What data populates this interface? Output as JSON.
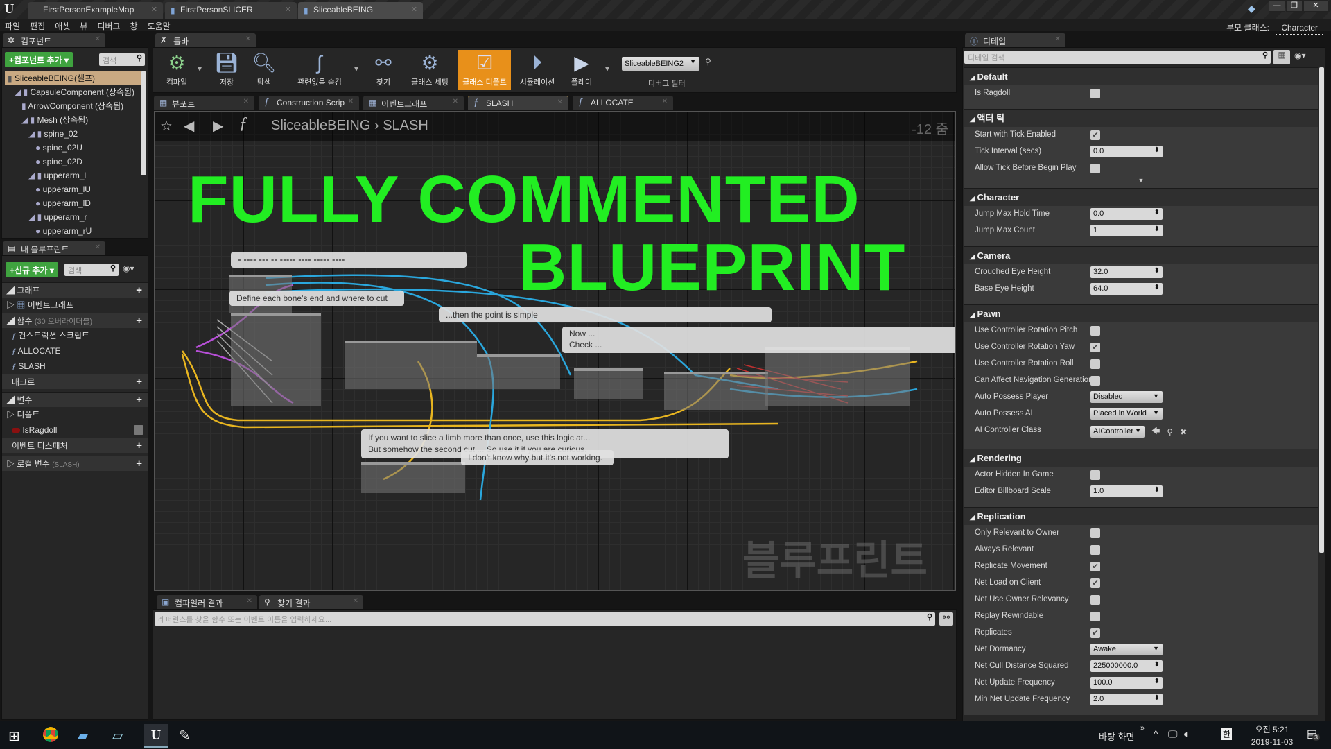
{
  "window": {
    "tabs": [
      "FirstPersonExampleMap",
      "FirstPersonSLICER",
      "SliceableBEING"
    ],
    "active_tab": 2,
    "controls": [
      "—",
      "❐",
      "✕"
    ]
  },
  "menu": [
    "파일",
    "편집",
    "애셋",
    "뷰",
    "디버그",
    "창",
    "도움말"
  ],
  "parent_class": {
    "label": "부모 클래스:",
    "value": "Character"
  },
  "components": {
    "tab": "컴포넌트",
    "add_button": "+컴포넌트 추가",
    "search_placeholder": "검색",
    "tree": [
      {
        "label": "SliceableBEING(셀프)",
        "depth": 0
      },
      {
        "label": "CapsuleComponent (상속됨)",
        "depth": 1
      },
      {
        "label": "ArrowComponent (상속됨)",
        "depth": 2
      },
      {
        "label": "Mesh (상속됨)",
        "depth": 2
      },
      {
        "label": "spine_02",
        "depth": 3
      },
      {
        "label": "spine_02U",
        "depth": 4
      },
      {
        "label": "spine_02D",
        "depth": 4
      },
      {
        "label": "upperarm_l",
        "depth": 3
      },
      {
        "label": "upperarm_lU",
        "depth": 4
      },
      {
        "label": "upperarm_lD",
        "depth": 4
      },
      {
        "label": "upperarm_r",
        "depth": 3
      },
      {
        "label": "upperarm_rU",
        "depth": 4
      }
    ]
  },
  "my_blueprint": {
    "tab": "내 블루프린트",
    "add_button": "+신규 추가",
    "search_placeholder": "검색",
    "graphs_header": "그래프",
    "event_graph": "이벤트그래프",
    "functions_header": "함수",
    "functions_note": "(30 오버라이더블)",
    "functions": [
      "컨스트럭션 스크립트",
      "ALLOCATE",
      "SLASH"
    ],
    "macros_header": "매크로",
    "variables_header": "변수",
    "defaults_category": "디폴트",
    "variable": "IsRagdoll",
    "dispatchers_header": "이벤트 디스패처",
    "local_vars_header": "로컬 변수",
    "local_vars_note": "(SLASH)"
  },
  "toolbar": {
    "tab": "툴바",
    "buttons": [
      "컴파일",
      "저장",
      "탐색",
      "관련없음 숨김",
      "찾기",
      "클래스 세팅",
      "클래스 디폴트",
      "시뮬레이션",
      "플레이"
    ],
    "active_button": "클래스 디폴트",
    "debug_object": "SliceableBEING2",
    "debug_filter": "디버그 필터"
  },
  "graph_tabs": [
    "뷰포트",
    "Construction Scrip",
    "이벤트그래프",
    "SLASH",
    "ALLOCATE"
  ],
  "active_graph_tab": "SLASH",
  "breadcrumb": [
    "SliceableBEING",
    "SLASH"
  ],
  "zoom_level": "-12 줌",
  "graph": {
    "headline_1": "FULLY COMMENTED",
    "headline_2": "BLUEPRINT",
    "headline_color": "#22ee22",
    "watermark": "블루프린트",
    "comments": [
      "Define each bone's end and where to cut",
      "Now ...",
      "Check ...",
      "...then the point is simple",
      "If you want to slice a limb more than once, use this logic at...",
      "But somehow the second cut ... So use it if you are curious.",
      "I don't know why but it's not working."
    ]
  },
  "results": {
    "tabs": [
      "컴파일러 결과",
      "찾기 결과"
    ],
    "search_placeholder": "레퍼런스를 찾을 함수 또는 이벤트 이름을 입력하세요..."
  },
  "details": {
    "tab": "디테일",
    "search_placeholder": "디테일 검색",
    "sections": [
      {
        "title": "Default",
        "rows": [
          {
            "label": "Is Ragdoll",
            "type": "check",
            "value": false
          }
        ]
      },
      {
        "title": "액터 틱",
        "rows": [
          {
            "label": "Start with Tick Enabled",
            "type": "check",
            "value": true
          },
          {
            "label": "Tick Interval (secs)",
            "type": "num",
            "value": "0.0"
          },
          {
            "label": "Allow Tick Before Begin Play",
            "type": "check",
            "value": false
          }
        ],
        "expander": true
      },
      {
        "title": "Character",
        "rows": [
          {
            "label": "Jump Max Hold Time",
            "type": "num",
            "value": "0.0"
          },
          {
            "label": "Jump Max Count",
            "type": "num",
            "value": "1"
          }
        ]
      },
      {
        "title": "Camera",
        "rows": [
          {
            "label": "Crouched Eye Height",
            "type": "num",
            "value": "32.0"
          },
          {
            "label": "Base Eye Height",
            "type": "num",
            "value": "64.0"
          }
        ]
      },
      {
        "title": "Pawn",
        "rows": [
          {
            "label": "Use Controller Rotation Pitch",
            "type": "check",
            "value": false
          },
          {
            "label": "Use Controller Rotation Yaw",
            "type": "check",
            "value": true
          },
          {
            "label": "Use Controller Rotation Roll",
            "type": "check",
            "value": false
          },
          {
            "label": "Can Affect Navigation Generation",
            "type": "check",
            "value": false
          },
          {
            "label": "Auto Possess Player",
            "type": "dd",
            "value": "Disabled"
          },
          {
            "label": "Auto Possess AI",
            "type": "dd",
            "value": "Placed in World"
          },
          {
            "label": "AI Controller Class",
            "type": "class",
            "value": "AIController"
          }
        ]
      },
      {
        "title": "Rendering",
        "rows": [
          {
            "label": "Actor Hidden In Game",
            "type": "check",
            "value": false
          },
          {
            "label": "Editor Billboard Scale",
            "type": "num",
            "value": "1.0"
          }
        ]
      },
      {
        "title": "Replication",
        "rows": [
          {
            "label": "Only Relevant to Owner",
            "type": "check",
            "value": false
          },
          {
            "label": "Always Relevant",
            "type": "check",
            "value": false
          },
          {
            "label": "Replicate Movement",
            "type": "check",
            "value": true
          },
          {
            "label": "Net Load on Client",
            "type": "check",
            "value": true
          },
          {
            "label": "Net Use Owner Relevancy",
            "type": "check",
            "value": false
          },
          {
            "label": "Replay Rewindable",
            "type": "check",
            "value": false
          },
          {
            "label": "Replicates",
            "type": "check",
            "value": true
          },
          {
            "label": "Net Dormancy",
            "type": "dd",
            "value": "Awake"
          },
          {
            "label": "Net Cull Distance Squared",
            "type": "num",
            "value": "225000000.0"
          },
          {
            "label": "Net Update Frequency",
            "type": "num",
            "value": "100.0"
          },
          {
            "label": "Min Net Update Frequency",
            "type": "num",
            "value": "2.0"
          }
        ]
      }
    ]
  },
  "taskbar": {
    "desktop_label": "바탕 화면",
    "ime": "한",
    "time": "오전 5:21",
    "date": "2019-11-03",
    "notifications": "3"
  }
}
